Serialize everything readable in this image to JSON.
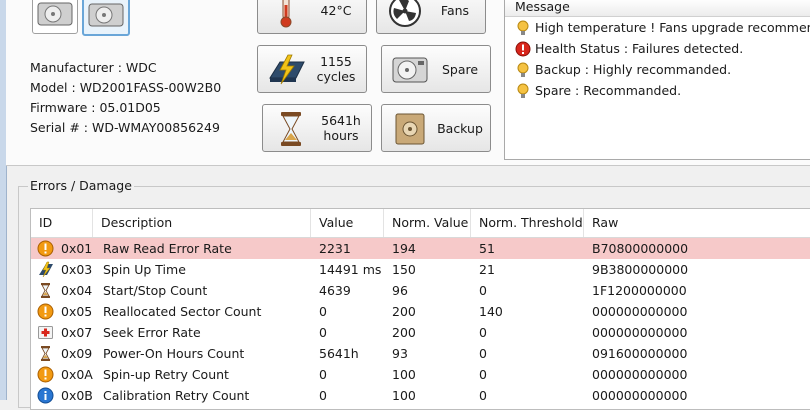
{
  "drive_info": {
    "manufacturer": "Manufacturer : WDC",
    "model": "Model : WD2001FASS-00W2B0",
    "firmware": "Firmware : 05.01D05",
    "serial": "Serial # : WD-WMAY00856249"
  },
  "buttons": {
    "temperature": "42°C",
    "fans": "Fans",
    "cycles": "1155\ncycles",
    "spare": "Spare",
    "hours": "5641h\nhours",
    "backup": "Backup"
  },
  "messages": {
    "header": "Message",
    "items": [
      {
        "icon": "bulb-icon",
        "text": "High temperature ! Fans upgrade recommended"
      },
      {
        "icon": "error-icon",
        "text": "Health Status : Failures detected."
      },
      {
        "icon": "bulb-icon",
        "text": "Backup : Highly recommanded."
      },
      {
        "icon": "bulb-icon",
        "text": "Spare : Recommanded."
      }
    ]
  },
  "errors": {
    "title": "Errors / Damage",
    "columns": [
      "ID",
      "Description",
      "Value",
      "Norm. Value",
      "Norm. Threshold",
      "Raw"
    ],
    "rows": [
      {
        "icon": "warning-icon",
        "id": "0x01",
        "desc": "Raw Read Error Rate",
        "value": "2231",
        "norm": "194",
        "thresh": "51",
        "raw": "B70800000000",
        "highlight": true
      },
      {
        "icon": "spin-icon",
        "id": "0x03",
        "desc": "Spin Up Time",
        "value": "14491 ms",
        "norm": "150",
        "thresh": "21",
        "raw": "9B3800000000"
      },
      {
        "icon": "hourglass-icon",
        "id": "0x04",
        "desc": "Start/Stop Count",
        "value": "4639",
        "norm": "96",
        "thresh": "0",
        "raw": "1F1200000000"
      },
      {
        "icon": "warning-icon",
        "id": "0x05",
        "desc": "Reallocated Sector Count",
        "value": "0",
        "norm": "200",
        "thresh": "140",
        "raw": "000000000000"
      },
      {
        "icon": "firstaid-icon",
        "id": "0x07",
        "desc": "Seek Error Rate",
        "value": "0",
        "norm": "200",
        "thresh": "0",
        "raw": "000000000000"
      },
      {
        "icon": "hourglass-icon",
        "id": "0x09",
        "desc": "Power-On Hours Count",
        "value": "5641h",
        "norm": "93",
        "thresh": "0",
        "raw": "091600000000"
      },
      {
        "icon": "warning-icon",
        "id": "0x0A",
        "desc": "Spin-up Retry Count",
        "value": "0",
        "norm": "100",
        "thresh": "0",
        "raw": "000000000000"
      },
      {
        "icon": "info-icon",
        "id": "0x0B",
        "desc": "Calibration Retry Count",
        "value": "0",
        "norm": "100",
        "thresh": "0",
        "raw": "000000000000"
      }
    ]
  }
}
